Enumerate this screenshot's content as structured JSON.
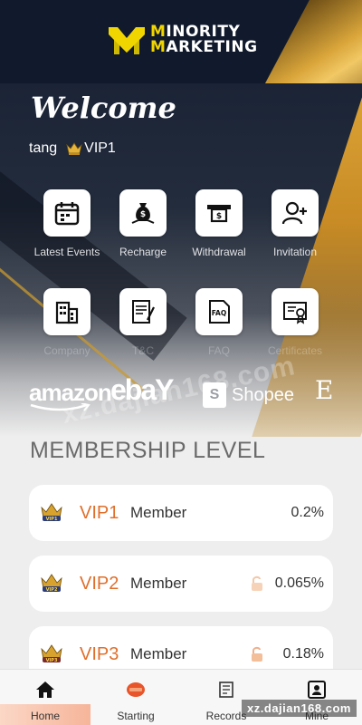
{
  "header": {
    "logo_line1_hl": "M",
    "logo_line1_rest": "INORITY",
    "logo_line2_hl": "M",
    "logo_line2_rest": "ARKETING",
    "colors": {
      "background": "#111a2c",
      "logo_accent": "#f0d500",
      "gold": "#d9a53a"
    }
  },
  "hero": {
    "welcome": "Welcome",
    "username": "tang",
    "vip_label": "VIP1",
    "actions_row1": [
      {
        "label": "Latest Events",
        "icon": "calendar-icon"
      },
      {
        "label": "Recharge",
        "icon": "money-bag-icon"
      },
      {
        "label": "Withdrawal",
        "icon": "withdraw-icon"
      },
      {
        "label": "Invitation",
        "icon": "add-user-icon"
      }
    ],
    "actions_row2": [
      {
        "label": "Company",
        "icon": "building-icon"
      },
      {
        "label": "T&C",
        "icon": "document-icon"
      },
      {
        "label": "FAQ",
        "icon": "faq-icon"
      },
      {
        "label": "Certificates",
        "icon": "certificate-icon"
      }
    ],
    "brands": [
      "amazon",
      "ebaY",
      "Shopee",
      "E"
    ]
  },
  "membership": {
    "title": "MEMBERSHIP LEVEL",
    "levels": [
      {
        "name": "VIP1",
        "member": "Member",
        "rate": "0.2%",
        "locked": false
      },
      {
        "name": "VIP2",
        "member": "Member",
        "rate": "0.065%",
        "locked": true
      },
      {
        "name": "VIP3",
        "member": "Member",
        "rate": "0.18%",
        "locked": true
      }
    ],
    "accent_color": "#e06f2b"
  },
  "bottom_nav": {
    "items": [
      {
        "label": "Home",
        "icon": "home-icon",
        "active": true
      },
      {
        "label": "Starting",
        "icon": "start-badge-icon",
        "active": false
      },
      {
        "label": "Records",
        "icon": "scroll-icon",
        "active": false
      },
      {
        "label": "Mine",
        "icon": "profile-card-icon",
        "active": false
      }
    ]
  },
  "watermark": "xz.dajian168.com",
  "faint_watermark": "xz.dajian168.com"
}
